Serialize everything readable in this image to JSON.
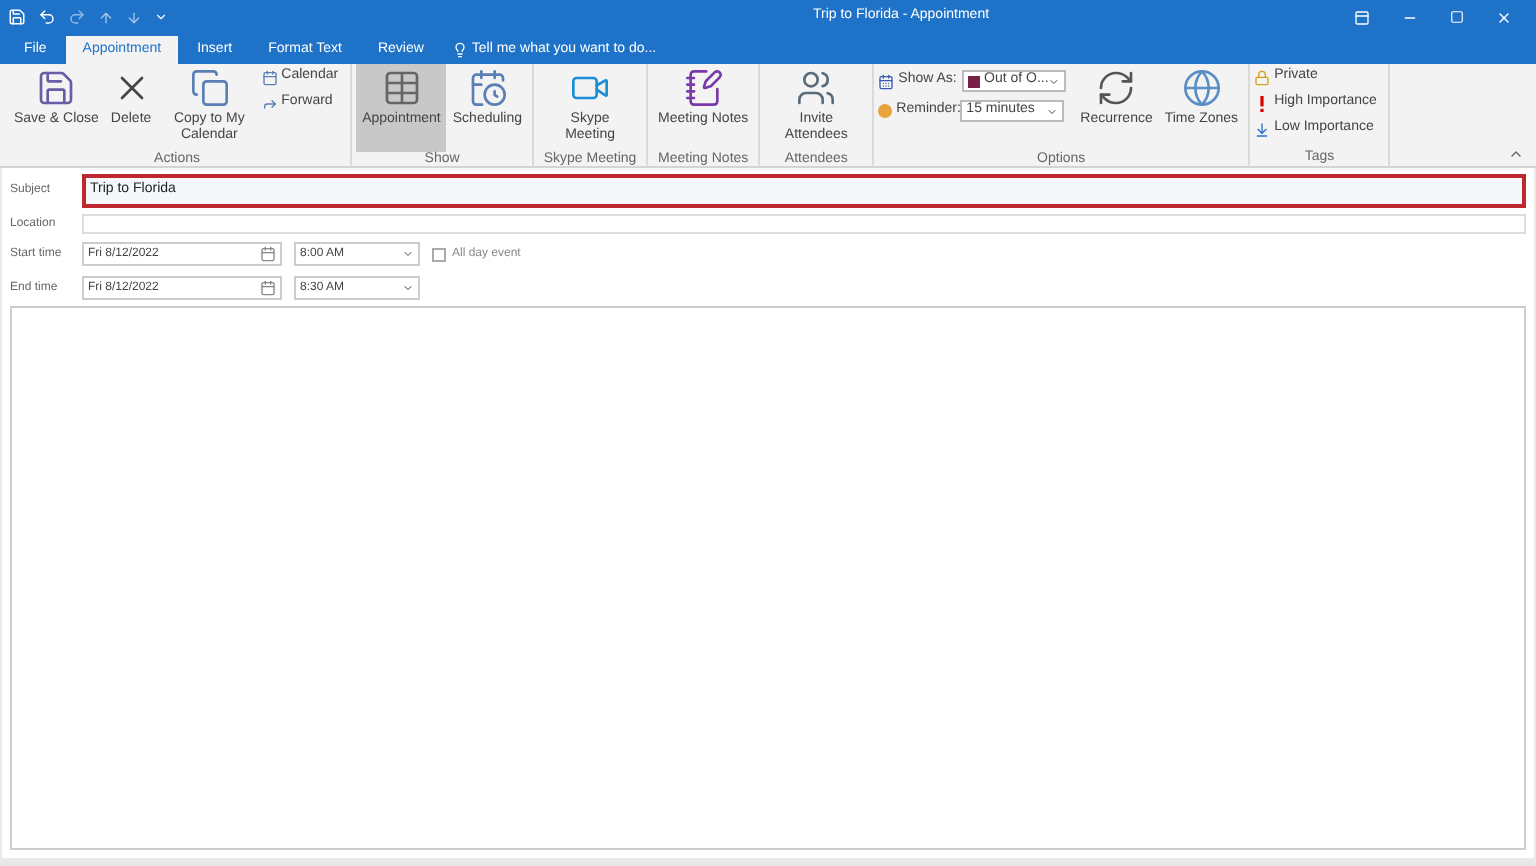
{
  "window": {
    "title": "Trip to Florida - Appointment"
  },
  "tabs": [
    {
      "label": "File",
      "selected": false
    },
    {
      "label": "Appointment",
      "selected": true
    },
    {
      "label": "Insert",
      "selected": false
    },
    {
      "label": "Format Text",
      "selected": false
    },
    {
      "label": "Review",
      "selected": false
    }
  ],
  "tell_me": "Tell me what you want to do...",
  "ribbon": [
    {
      "label": "Actions",
      "items": [
        {
          "kind": "large",
          "label": "Save & Close",
          "selected": false
        },
        {
          "kind": "large",
          "label": "Delete",
          "selected": false
        },
        {
          "kind": "large",
          "label": "Copy to My Calendar",
          "selected": false
        },
        {
          "kind": "stack",
          "items": [
            {
              "label": "Calendar"
            },
            {
              "label": "Forward"
            }
          ]
        }
      ]
    },
    {
      "label": "Show",
      "items": [
        {
          "kind": "large",
          "label": "Appointment",
          "selected": true
        },
        {
          "kind": "large",
          "label": "Scheduling",
          "selected": false
        }
      ]
    },
    {
      "label": "Skype Meeting",
      "items": [
        {
          "kind": "large",
          "label": "Skype Meeting",
          "selected": false
        }
      ]
    },
    {
      "label": "Meeting Notes",
      "items": [
        {
          "kind": "large",
          "label": "Meeting Notes",
          "selected": false
        }
      ]
    },
    {
      "label": "Attendees",
      "items": [
        {
          "kind": "large",
          "label": "Invite Attendees",
          "selected": false
        }
      ]
    },
    {
      "label": "Options",
      "items": [
        {
          "kind": "dropdowns",
          "items": [
            {
              "label": "Show As:",
              "value": "Out of O...",
              "color": "#7a1f45"
            },
            {
              "label": "Reminder:",
              "value": "15 minutes"
            }
          ]
        },
        {
          "kind": "large",
          "label": "Recurrence",
          "selected": false
        },
        {
          "kind": "large",
          "label": "Time Zones",
          "selected": false
        }
      ]
    },
    {
      "label": "Tags",
      "items": [
        {
          "kind": "stack",
          "items": [
            {
              "label": "Private"
            },
            {
              "label": "High Importance"
            },
            {
              "label": "Low Importance"
            }
          ]
        }
      ]
    }
  ],
  "form": {
    "subject": {
      "label": "Subject",
      "value": "Trip to Florida",
      "highlighted": true
    },
    "location": {
      "label": "Location"
    },
    "times": [
      {
        "label": "Start time",
        "date": "Fri 8/12/2022",
        "time": "8:00 AM"
      },
      {
        "label": "End time",
        "date": "Fri 8/12/2022",
        "time": "8:30 AM"
      }
    ],
    "all_day": {
      "label": "All day event",
      "checked": false
    }
  }
}
